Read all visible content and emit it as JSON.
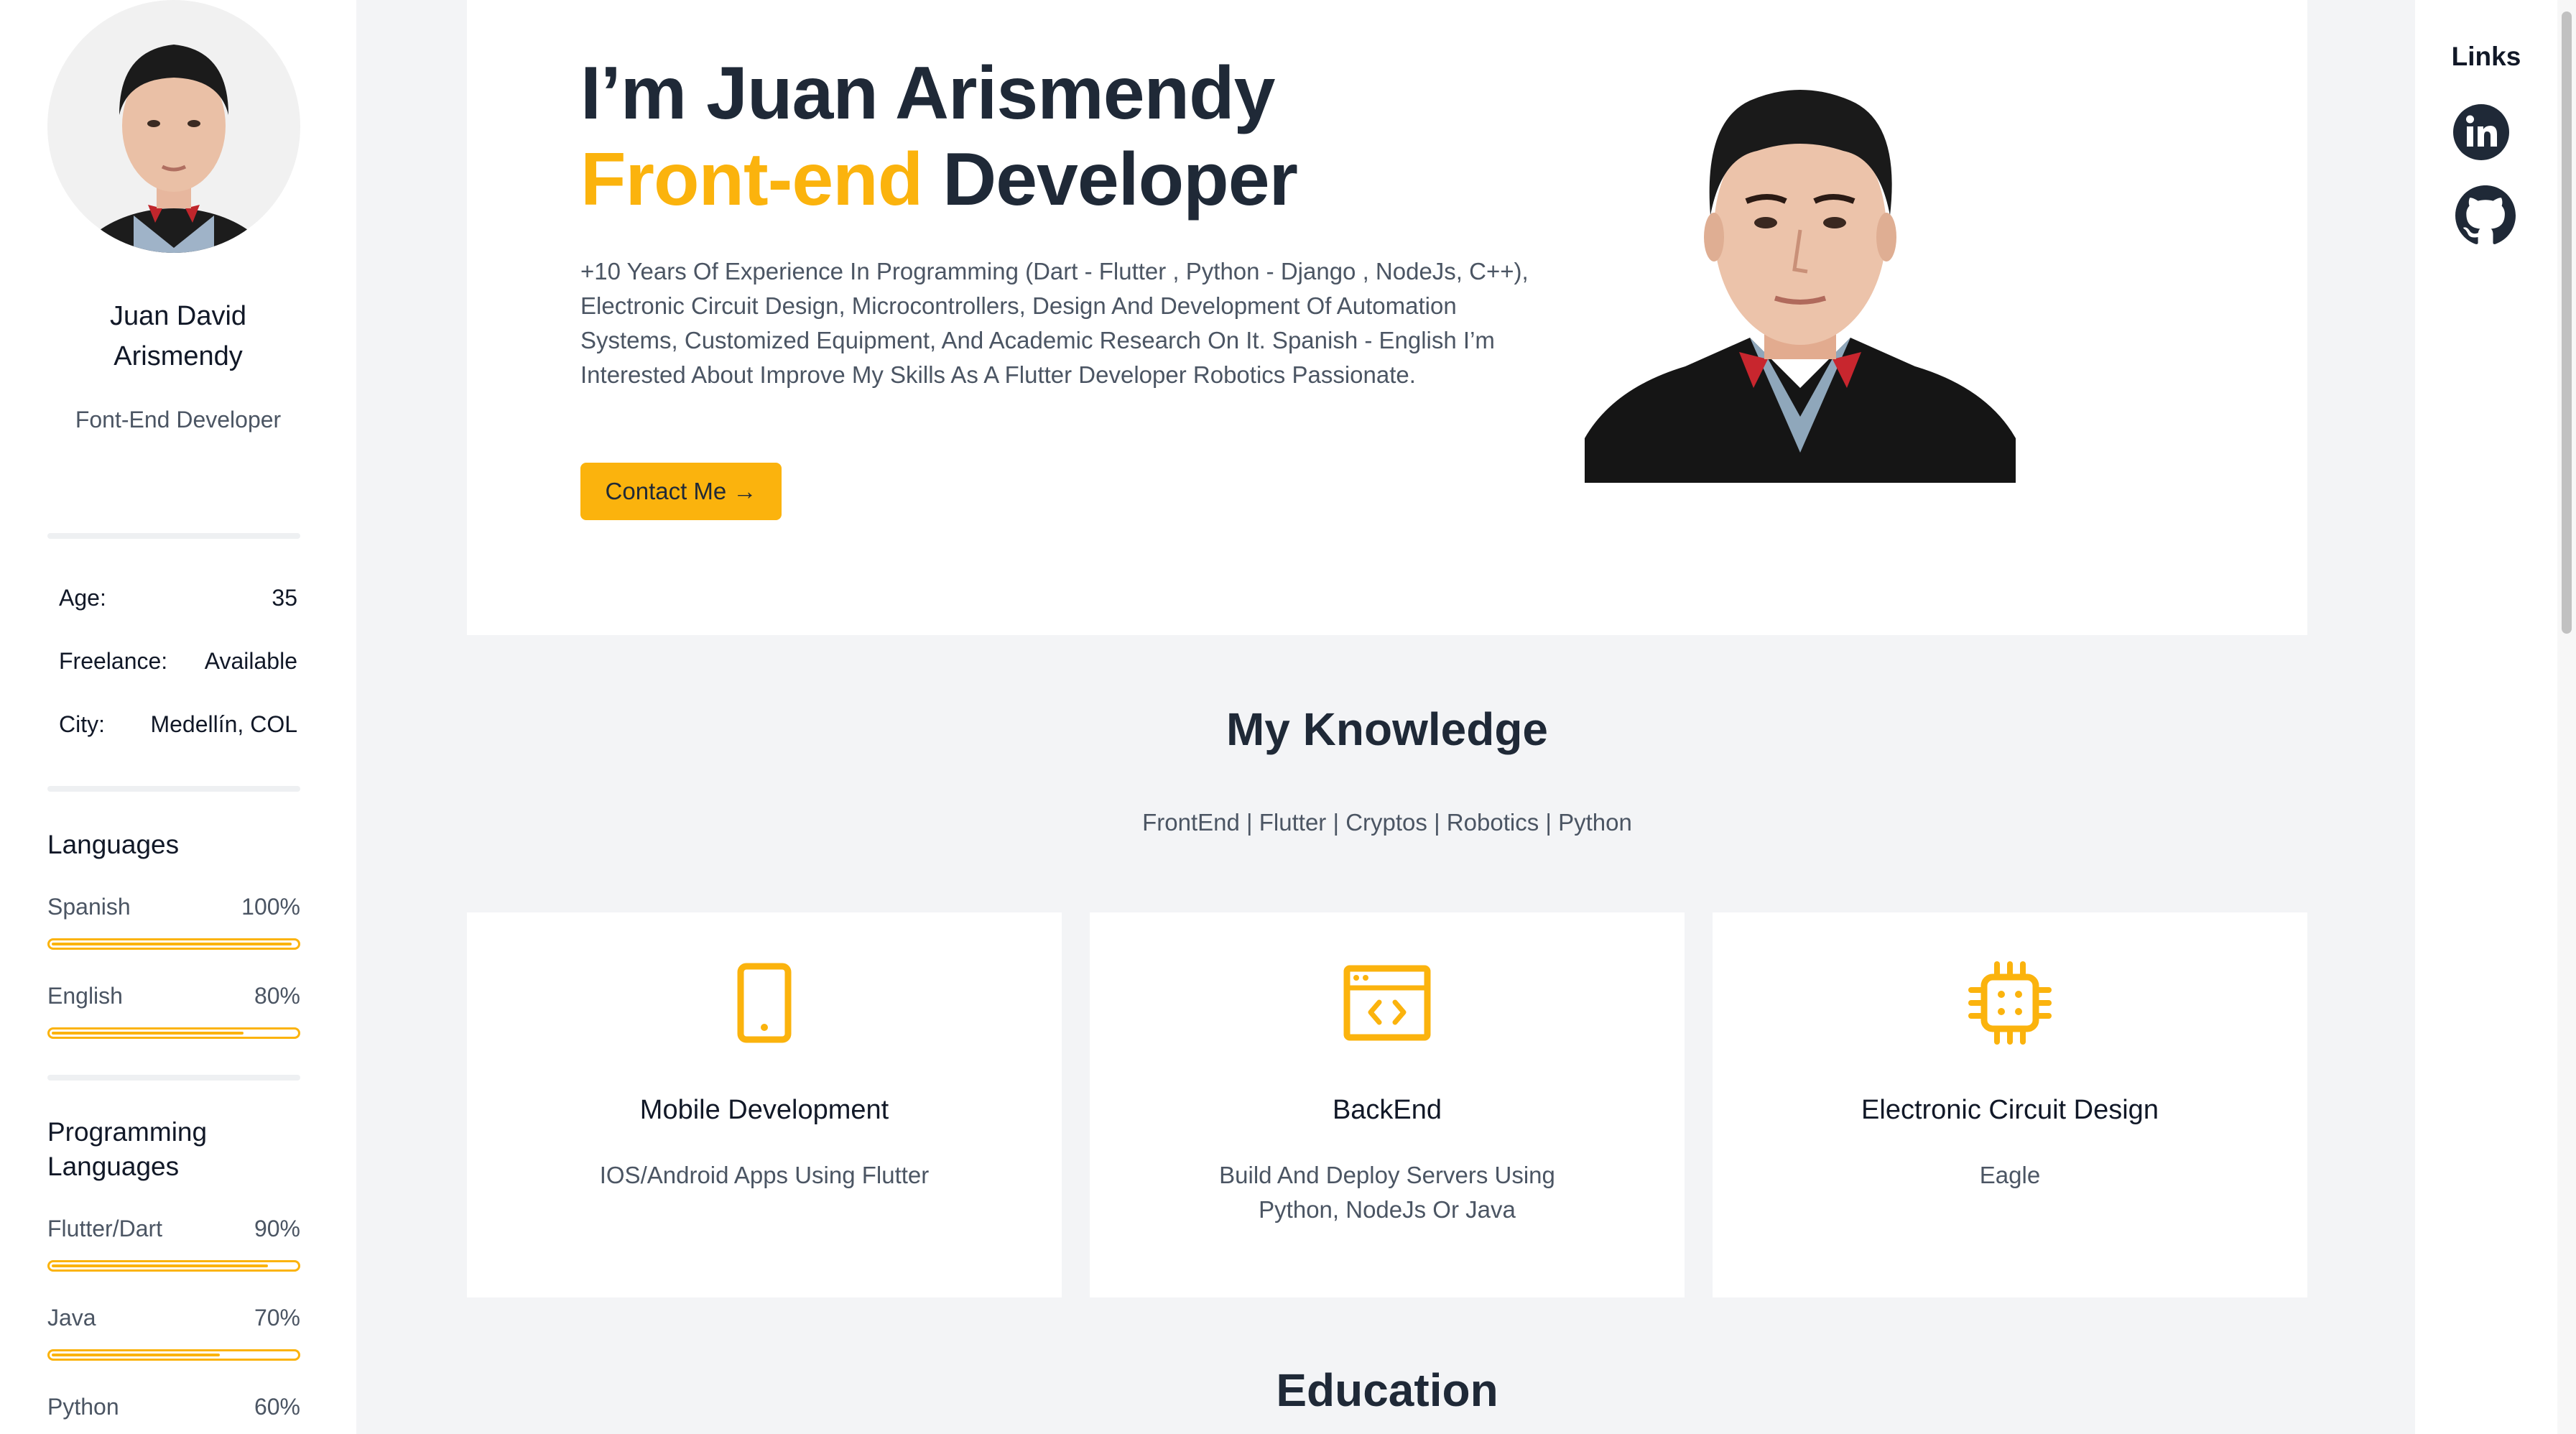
{
  "sidebar": {
    "name_line1": "Juan David",
    "name_line2": "Arismendy",
    "role": "Font-End Developer",
    "info": [
      {
        "label": "Age:",
        "value": "35"
      },
      {
        "label": "Freelance:",
        "value": "Available"
      },
      {
        "label": "City:",
        "value": "Medellín, COL"
      }
    ],
    "languages_title": "Languages",
    "languages": [
      {
        "name": "Spanish",
        "percent_label": "100%",
        "level": 100
      },
      {
        "name": "English",
        "percent_label": "80%",
        "level": 80
      }
    ],
    "programming_title_line1": "Programming",
    "programming_title_line2": "Languages",
    "programming": [
      {
        "name": "Flutter/Dart",
        "percent_label": "90%",
        "level": 90
      },
      {
        "name": "Java",
        "percent_label": "70%",
        "level": 70
      },
      {
        "name": "Python",
        "percent_label": "60%",
        "level": 60
      }
    ]
  },
  "hero": {
    "title_line1": "I’m Juan Arismendy",
    "title_accent": "Front-end",
    "title_rest": " Developer",
    "description": "+10 Years Of Experience In Programming (Dart - Flutter , Python - Django , NodeJs, C++), Electronic Circuit Design, Microcontrollers, Design And Development Of Automation Systems, Customized Equipment, And Academic Research On It. Spanish - English I’m Interested About Improve My Skills As A Flutter Developer Robotics Passionate.",
    "contact_label": "Contact Me →"
  },
  "knowledge": {
    "title": "My Knowledge",
    "tags": "FrontEnd | Flutter | Cryptos | Robotics | Python",
    "cards": [
      {
        "title": "Mobile Development",
        "description": "IOS/Android Apps Using Flutter",
        "icon": "mobile-phone-icon"
      },
      {
        "title": "BackEnd",
        "description": "Build And Deploy Servers Using Python, NodeJs Or Java",
        "icon": "browser-code-icon"
      },
      {
        "title": "Electronic Circuit Design",
        "description": "Eagle",
        "icon": "chip-icon"
      }
    ]
  },
  "education": {
    "title": "Education"
  },
  "links": {
    "title": "Links",
    "items": [
      {
        "icon": "linkedin-icon"
      },
      {
        "icon": "github-icon"
      }
    ]
  },
  "colors": {
    "accent": "#fbb30d",
    "text_dark": "#1f2937",
    "text_muted": "#4b5563",
    "page_bg": "#f3f4f6"
  }
}
